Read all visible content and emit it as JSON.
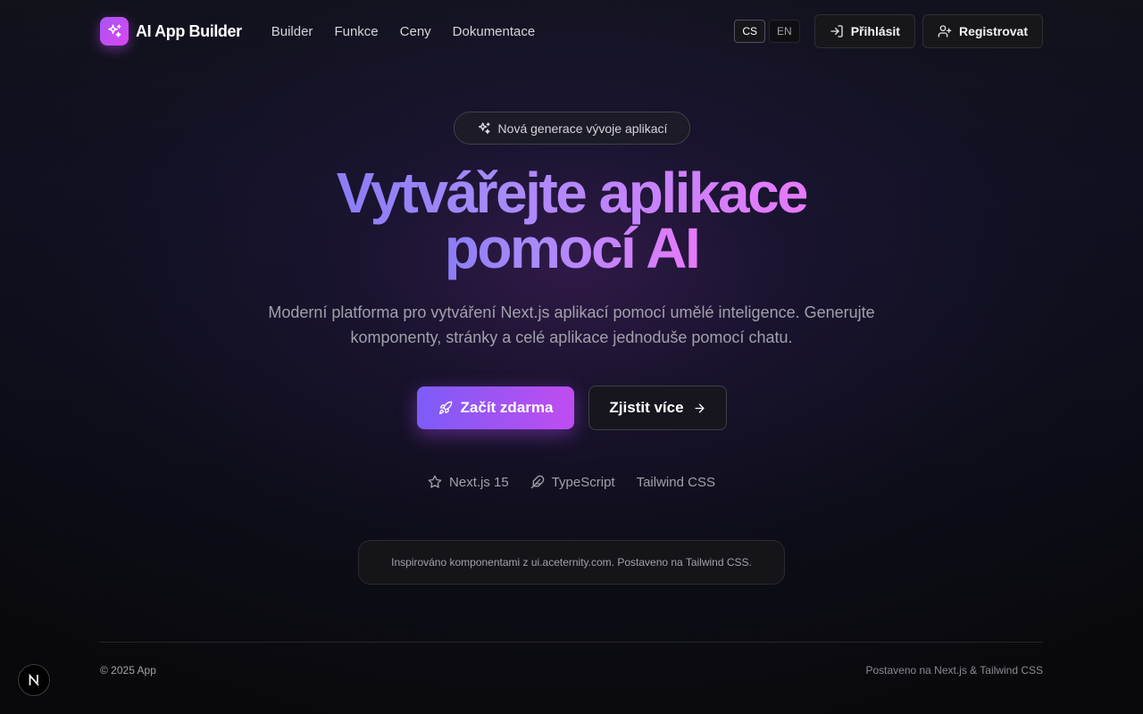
{
  "header": {
    "app_name": "AI App Builder",
    "logo_icon": "sparkles-icon",
    "nav": [
      {
        "label": "Builder"
      },
      {
        "label": "Funkce"
      },
      {
        "label": "Ceny"
      },
      {
        "label": "Dokumentace"
      }
    ],
    "languages": [
      {
        "code": "CS",
        "active": true
      },
      {
        "code": "EN",
        "active": false
      }
    ],
    "login_label": "Přihlásit",
    "login_icon": "log-in-icon",
    "register_label": "Registrovat",
    "register_icon": "user-plus-icon"
  },
  "hero": {
    "badge_text": "Nová generace vývoje aplikací",
    "badge_icon": "sparkles-icon",
    "headline_line1": "Vytvářejte aplikace",
    "headline_line2": "pomocí AI",
    "subtitle": "Moderní platforma pro vytváření Next.js aplikací pomocí umělé inteligence. Generujte komponenty, stránky a celé aplikace jednoduše pomocí chatu.",
    "cta_primary": "Začít zdarma",
    "cta_primary_icon": "rocket-icon",
    "cta_secondary": "Zjistit více",
    "cta_secondary_icon": "arrow-right-icon",
    "tech": [
      {
        "label": "Next.js 15",
        "icon": "star-icon"
      },
      {
        "label": "TypeScript",
        "icon": "feather-icon"
      },
      {
        "label": "Tailwind CSS"
      }
    ],
    "note": "Inspirováno komponentami z ui.aceternity.com. Postaveno na Tailwind CSS."
  },
  "footer": {
    "copyright": "© 2025 App",
    "built_with": "Postaveno na Next.js & Tailwind CSS"
  },
  "colors": {
    "accent_start": "#8b7cf6",
    "accent_end": "#e879f9",
    "background": "#09090b"
  }
}
